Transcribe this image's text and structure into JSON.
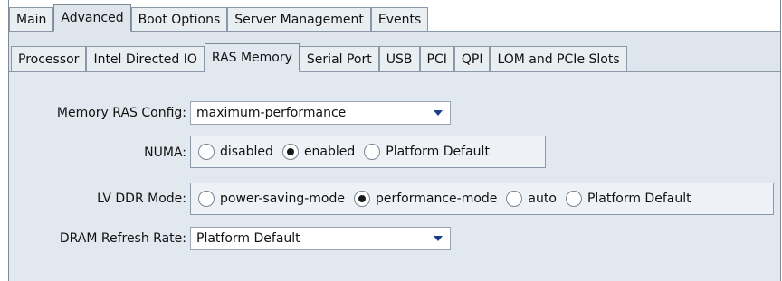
{
  "top_tabs": [
    {
      "label": "Main",
      "active": false
    },
    {
      "label": "Advanced",
      "active": true
    },
    {
      "label": "Boot Options",
      "active": false
    },
    {
      "label": "Server Management",
      "active": false
    },
    {
      "label": "Events",
      "active": false
    }
  ],
  "sub_tabs": [
    {
      "label": "Processor",
      "active": false
    },
    {
      "label": "Intel Directed IO",
      "active": false
    },
    {
      "label": "RAS Memory",
      "active": true
    },
    {
      "label": "Serial Port",
      "active": false
    },
    {
      "label": "USB",
      "active": false
    },
    {
      "label": "PCI",
      "active": false
    },
    {
      "label": "QPI",
      "active": false
    },
    {
      "label": "LOM and PCIe Slots",
      "active": false
    }
  ],
  "form": {
    "memory_ras": {
      "label": "Memory RAS Config:",
      "value": "maximum-performance"
    },
    "numa": {
      "label": "NUMA:",
      "options": [
        "disabled",
        "enabled",
        "Platform Default"
      ],
      "selected": "enabled"
    },
    "lv_ddr": {
      "label": "LV DDR Mode:",
      "options": [
        "power-saving-mode",
        "performance-mode",
        "auto",
        "Platform Default"
      ],
      "selected": "performance-mode"
    },
    "dram_refresh": {
      "label": "DRAM Refresh Rate:",
      "value": "Platform Default"
    }
  },
  "colors": {
    "panel": "#e2e8ef",
    "tab_border": "#8b98a8",
    "dropdown_arrow": "#1b3c8a"
  }
}
